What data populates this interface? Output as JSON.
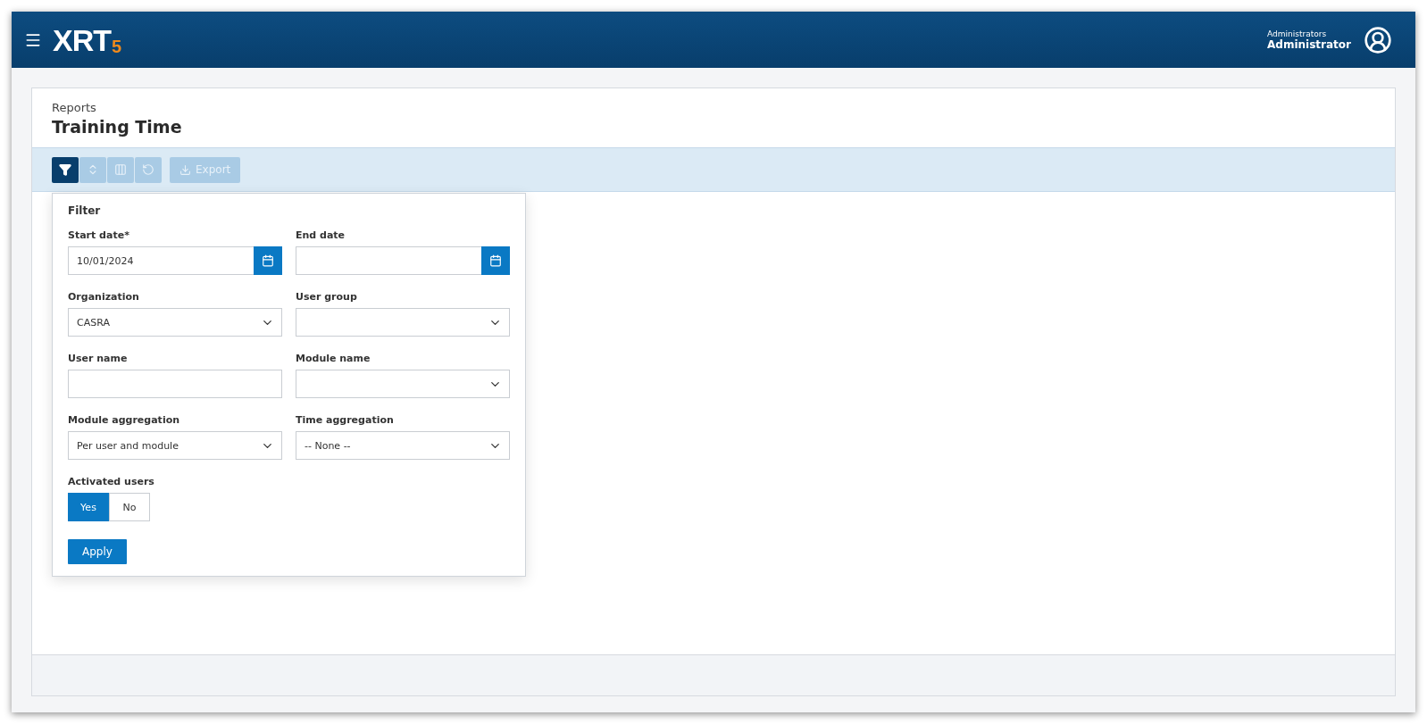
{
  "header": {
    "logo": {
      "name": "XRT",
      "version": "5"
    },
    "user": {
      "role": "Administrators",
      "name": "Administrator"
    }
  },
  "page": {
    "breadcrumb": "Reports",
    "title": "Training Time"
  },
  "toolbar": {
    "buttons": [
      {
        "kind": "filter",
        "selected": true,
        "disabled": false
      },
      {
        "kind": "expand",
        "selected": false,
        "disabled": true
      },
      {
        "kind": "columns",
        "selected": false,
        "disabled": true
      },
      {
        "kind": "reset",
        "selected": false,
        "disabled": true
      }
    ],
    "export": {
      "label": "Export",
      "disabled": true
    }
  },
  "filter": {
    "title": "Filter",
    "fields": [
      {
        "kind": "date",
        "label": "Start date*",
        "value": "10/01/2024"
      },
      {
        "kind": "date",
        "label": "End date"
      },
      {
        "kind": "select",
        "label": "Organization",
        "value": "CASRA"
      },
      {
        "kind": "select",
        "label": "User group"
      },
      {
        "kind": "text",
        "label": "User name"
      },
      {
        "kind": "select",
        "label": "Module name"
      },
      {
        "kind": "select",
        "label": "Module aggregation",
        "value": "Per user and module"
      },
      {
        "kind": "select",
        "label": "Time aggregation",
        "value": "-- None --"
      }
    ],
    "activated_users": {
      "label": "Activated users",
      "options": [
        {
          "label": "Yes",
          "selected": true
        },
        {
          "label": "No",
          "selected": false
        }
      ]
    },
    "apply": "Apply"
  }
}
